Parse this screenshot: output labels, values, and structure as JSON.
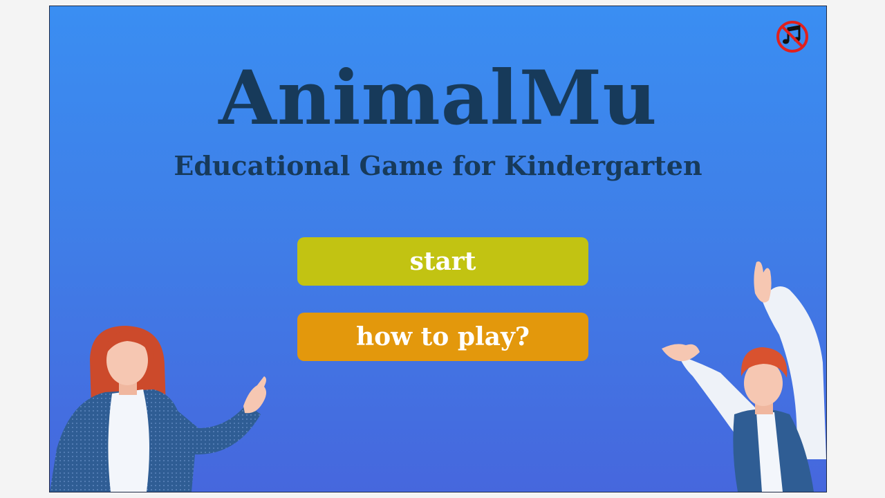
{
  "game": {
    "title": "AnimalMu",
    "subtitle": "Educational Game for Kindergarten"
  },
  "menu": {
    "start_label": "start",
    "howto_label": "how to play?"
  },
  "controls": {
    "music_icon": "music-muted-icon"
  },
  "colors": {
    "background_top": "#3a8ef2",
    "background_bottom": "#4667dd",
    "title": "#173a5a",
    "start_button": "#c2c312",
    "howto_button": "#e3980c",
    "mute_ring": "#e0201c"
  },
  "illustrations": [
    "woman-waving",
    "man-cheering"
  ]
}
